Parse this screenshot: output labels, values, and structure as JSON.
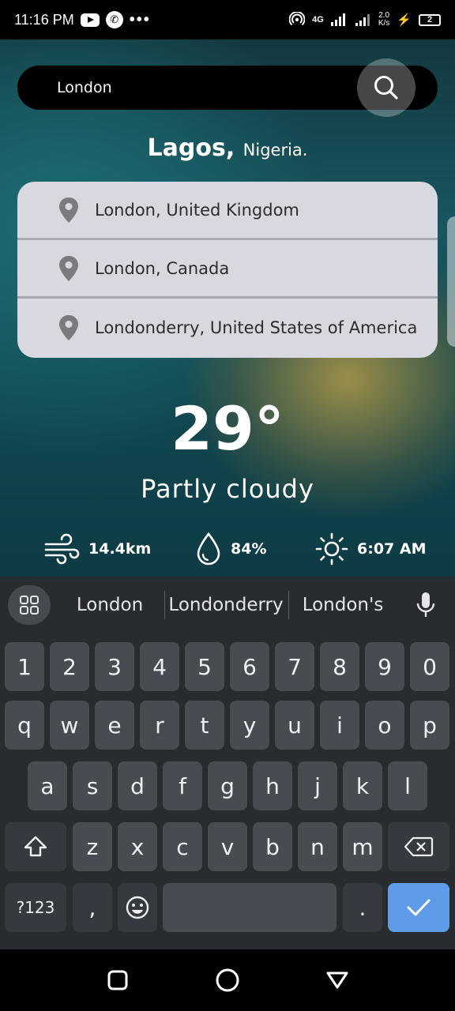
{
  "status_bar": {
    "time": "11:16 PM",
    "network": "4G",
    "speed_value": "2.0",
    "speed_unit": "K/s",
    "battery": "2"
  },
  "search": {
    "value": "London",
    "icon": "search-icon"
  },
  "current_location": {
    "city": "Lagos,",
    "country": "Nigeria."
  },
  "results": [
    {
      "label": "London, United Kingdom",
      "icon": "map-pin-icon"
    },
    {
      "label": "London, Canada",
      "icon": "map-pin-icon"
    },
    {
      "label": "Londonderry, United States of America",
      "icon": "map-pin-icon"
    }
  ],
  "weather": {
    "temperature": "29°",
    "condition": "Partly cloudy",
    "wind": "14.4km",
    "humidity": "84%",
    "sunrise": "6:07 AM"
  },
  "keyboard": {
    "suggestions": [
      "London",
      "Londonderry",
      "London's"
    ],
    "number_row": [
      "1",
      "2",
      "3",
      "4",
      "5",
      "6",
      "7",
      "8",
      "9",
      "0"
    ],
    "row1": [
      "q",
      "w",
      "e",
      "r",
      "t",
      "y",
      "u",
      "i",
      "o",
      "p"
    ],
    "row2": [
      "a",
      "s",
      "d",
      "f",
      "g",
      "h",
      "j",
      "k",
      "l"
    ],
    "row3": [
      "z",
      "x",
      "c",
      "v",
      "b",
      "n",
      "m"
    ],
    "symbols_label": "?123",
    "comma": ",",
    "period": ".",
    "accent_color": "#5e9ce8"
  },
  "colors": {
    "result_panel": "#d8d9e0",
    "keyboard_bg": "#282c31",
    "key_bg": "#474c53"
  }
}
